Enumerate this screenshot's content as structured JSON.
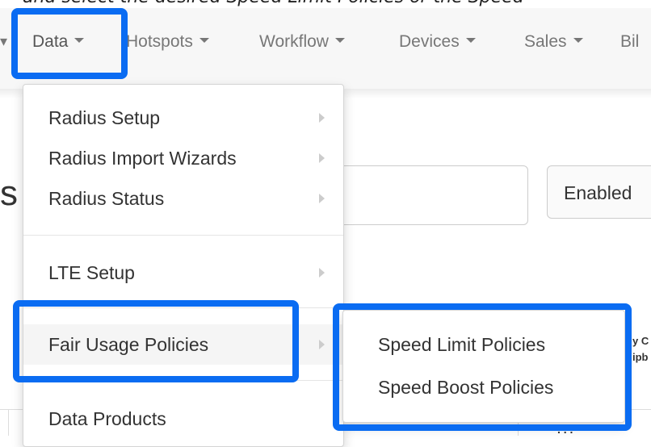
{
  "caption": "and select the desired Speed Limit Policies or the Speed",
  "nav": {
    "items": [
      {
        "label": "Data"
      },
      {
        "label": "Hotspots"
      },
      {
        "label": "Workflow"
      },
      {
        "label": "Devices"
      },
      {
        "label": "Sales"
      },
      {
        "label": "Bil"
      }
    ]
  },
  "page": {
    "heading_fragment": "s",
    "filter_selected": "Enabled",
    "table_header_fragment": [
      "y C",
      "ipb"
    ],
    "table_cell_fragment": ". . ."
  },
  "dropdown": {
    "items": [
      {
        "label": "Radius Setup",
        "submenu_icon": "chevron-right-icon"
      },
      {
        "label": "Radius Import Wizards",
        "submenu_icon": "chevron-right-icon"
      },
      {
        "label": "Radius Status",
        "submenu_icon": "chevron-right-icon"
      },
      {
        "label": "LTE Setup",
        "submenu_icon": "chevron-right-icon"
      },
      {
        "label": "Fair Usage Policies",
        "submenu_icon": "chevron-right-icon"
      },
      {
        "label": "Data Products"
      }
    ]
  },
  "submenu": {
    "items": [
      {
        "label": "Speed Limit Policies"
      },
      {
        "label": "Speed Boost Policies"
      }
    ]
  },
  "colors": {
    "highlight": "#0a6cf2",
    "nav_text": "#777777",
    "menu_text": "#333333",
    "hover_bg": "#f5f5f5"
  }
}
